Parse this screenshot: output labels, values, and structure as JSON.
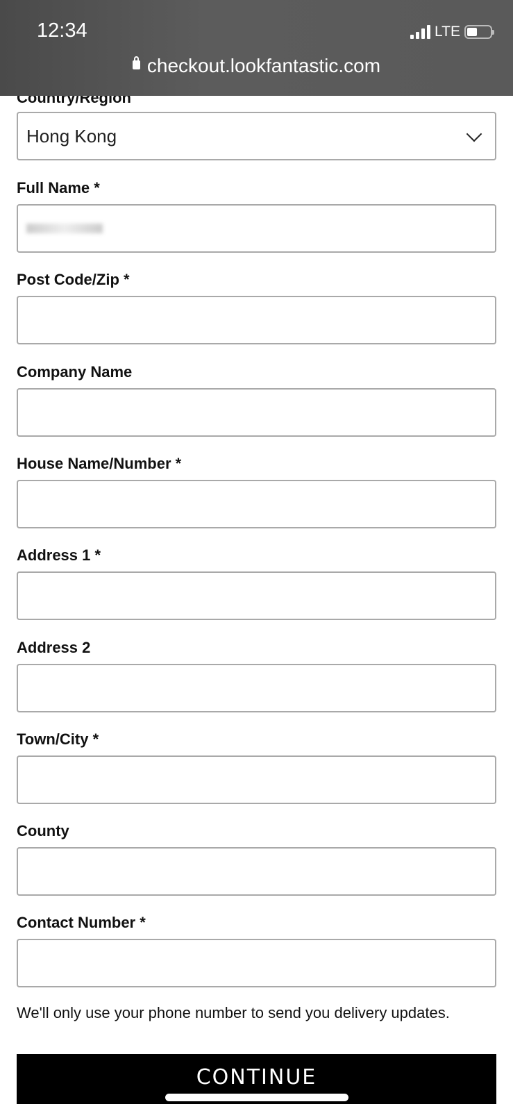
{
  "status_bar": {
    "time": "12:34",
    "network": "LTE"
  },
  "browser": {
    "url": "checkout.lookfantastic.com"
  },
  "form": {
    "country_label": "Country/Region",
    "country_value": "Hong Kong",
    "fields": [
      {
        "label": "Full Name *"
      },
      {
        "label": "Post Code/Zip *"
      },
      {
        "label": "Company Name"
      },
      {
        "label": "House Name/Number *"
      },
      {
        "label": "Address 1 *"
      },
      {
        "label": "Address 2"
      },
      {
        "label": "Town/City *"
      },
      {
        "label": "County"
      },
      {
        "label": "Contact Number *"
      }
    ],
    "phone_note": "We'll only use your phone number to send you delivery updates.",
    "continue_label": "CONTINUE"
  }
}
